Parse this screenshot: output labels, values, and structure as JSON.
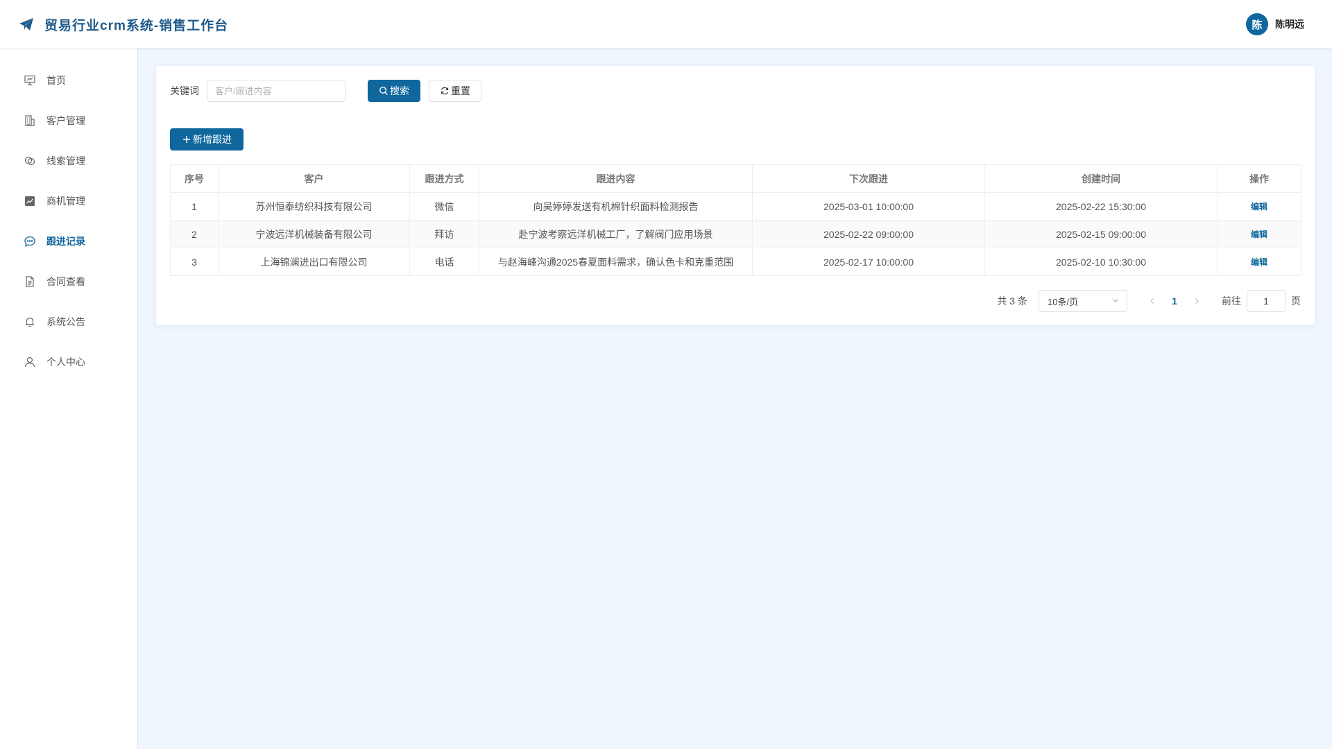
{
  "header": {
    "title": "贸易行业crm系统-销售工作台",
    "user": {
      "avatar_text": "陈",
      "name": "陈明远"
    }
  },
  "sidebar": {
    "items": [
      {
        "label": "首页",
        "icon": "presentation-icon",
        "active": false
      },
      {
        "label": "客户管理",
        "icon": "office-building-icon",
        "active": false
      },
      {
        "label": "线索管理",
        "icon": "link-icon",
        "active": false
      },
      {
        "label": "商机管理",
        "icon": "chart-icon",
        "active": false
      },
      {
        "label": "跟进记录",
        "icon": "chat-bubble-icon",
        "active": true
      },
      {
        "label": "合同查看",
        "icon": "document-icon",
        "active": false
      },
      {
        "label": "系统公告",
        "icon": "bell-icon",
        "active": false
      },
      {
        "label": "个人中心",
        "icon": "user-icon",
        "active": false
      }
    ]
  },
  "search": {
    "keyword_label": "关键词",
    "placeholder": "客户/跟进内容",
    "value": "",
    "search_label": "搜索",
    "reset_label": "重置"
  },
  "toolbar": {
    "add_label": "新增跟进"
  },
  "table": {
    "columns": [
      "序号",
      "客户",
      "跟进方式",
      "跟进内容",
      "下次跟进",
      "创建时间",
      "操作"
    ],
    "rows": [
      {
        "index": "1",
        "customer": "苏州恒泰纺织科技有限公司",
        "method": "微信",
        "content": "向吴婷婷发送有机棉针织面料检测报告",
        "next": "2025-03-01 10:00:00",
        "created": "2025-02-22 15:30:00",
        "action": "编辑"
      },
      {
        "index": "2",
        "customer": "宁波远洋机械装备有限公司",
        "method": "拜访",
        "content": "赴宁波考察远洋机械工厂，了解阀门应用场景",
        "next": "2025-02-22 09:00:00",
        "created": "2025-02-15 09:00:00",
        "action": "编辑"
      },
      {
        "index": "3",
        "customer": "上海锦澜进出口有限公司",
        "method": "电话",
        "content": "与赵海峰沟通2025春夏面料需求，确认色卡和克重范围",
        "next": "2025-02-17 10:00:00",
        "created": "2025-02-10 10:30:00",
        "action": "编辑"
      }
    ]
  },
  "pagination": {
    "total_text": "共 3 条",
    "page_size": "10条/页",
    "current_page": "1",
    "goto_label": "前往",
    "goto_value": "1",
    "page_suffix": "页"
  },
  "colors": {
    "primary": "#10679d",
    "background": "#eff6fd",
    "title": "#1e5a8a"
  }
}
